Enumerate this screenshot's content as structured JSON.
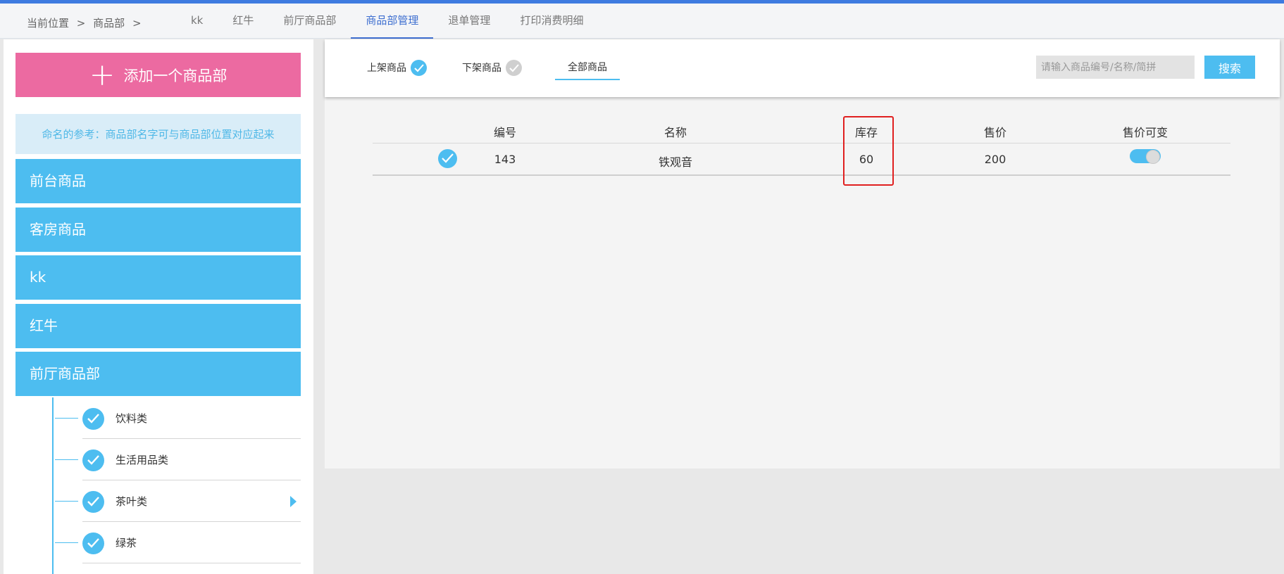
{
  "breadcrumb": {
    "current_label": "当前位置",
    "sep1": ">",
    "dept": "商品部",
    "sep2": ">"
  },
  "nav": {
    "tabs": [
      {
        "label": "kk"
      },
      {
        "label": "红牛"
      },
      {
        "label": "前厅商品部"
      },
      {
        "label": "商品部管理",
        "active": true
      },
      {
        "label": "退单管理"
      },
      {
        "label": "打印消费明细"
      }
    ]
  },
  "sidebar": {
    "add_button": {
      "icon": "plus-icon",
      "label": "添加一个商品部"
    },
    "hint": "命名的参考：商品部名字可与商品部位置对应起来",
    "departments": [
      {
        "label": "前台商品"
      },
      {
        "label": "客房商品"
      },
      {
        "label": "kk"
      },
      {
        "label": "红牛"
      },
      {
        "label": "前厅商品部"
      }
    ],
    "sub_items": [
      {
        "label": "饮料类"
      },
      {
        "label": "生活用品类"
      },
      {
        "label": "茶叶类",
        "selected": true
      },
      {
        "label": "绿茶"
      }
    ]
  },
  "filters": {
    "on_shelf": "上架商品",
    "off_shelf": "下架商品",
    "all": "全部商品",
    "search_placeholder": "请输入商品编号/名称/简拼",
    "search_button": "搜索"
  },
  "table": {
    "headers": {
      "id": "编号",
      "name": "名称",
      "stock": "库存",
      "price": "售价",
      "price_variable": "售价可变"
    },
    "rows": [
      {
        "checked": true,
        "id": "143",
        "name": "铁观音",
        "stock": "60",
        "price": "200",
        "price_variable": true
      }
    ]
  },
  "colors": {
    "accent_blue": "#4dbdf0",
    "add_button_pink": "#ec6aa1",
    "top_bar": "#3e7be0",
    "highlight_red": "#e02020"
  }
}
